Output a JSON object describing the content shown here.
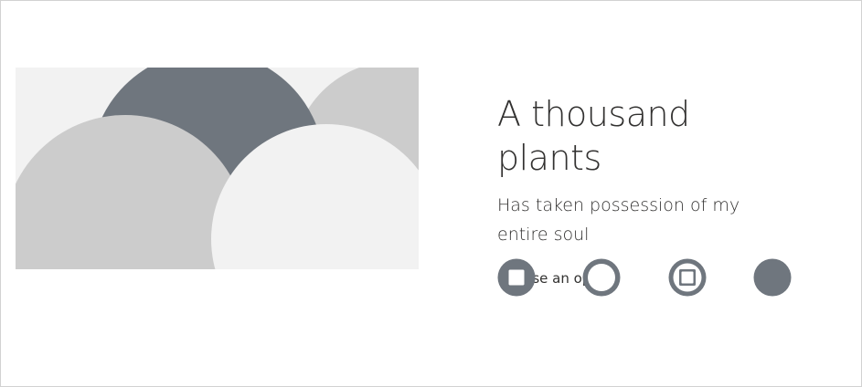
{
  "card": {
    "title": "A thousand plants",
    "subtitle": "Has taken possession of my entire soul",
    "option_label": "Choose an option"
  },
  "hero": {
    "description_icon": "decorative-circles-image",
    "colors": {
      "background": "#f2f2f2",
      "dark": "#6f767e",
      "light": "#cccccc",
      "lighter": "#f2f2f2"
    }
  },
  "options": [
    {
      "name": "stop-square-option-icon",
      "selected": false
    },
    {
      "name": "ring-option-icon",
      "selected": false
    },
    {
      "name": "stop-in-ring-option-icon",
      "selected": false
    },
    {
      "name": "filled-circle-option-icon",
      "selected": false
    }
  ],
  "colors": {
    "accent": "#6f767e",
    "text": "#323130",
    "border": "#d2d2d2"
  }
}
